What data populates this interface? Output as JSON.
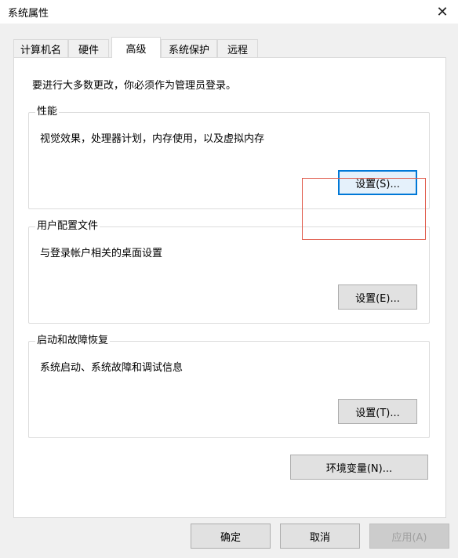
{
  "window": {
    "title": "系统属性",
    "close_glyph": "✕"
  },
  "tabs": [
    {
      "label": "计算机名"
    },
    {
      "label": "硬件"
    },
    {
      "label": "高级"
    },
    {
      "label": "系统保护"
    },
    {
      "label": "远程"
    }
  ],
  "active_tab": "高级",
  "advanced": {
    "admin_note": "要进行大多数更改，你必须作为管理员登录。",
    "performance": {
      "title": "性能",
      "desc": "视觉效果，处理器计划，内存使用，以及虚拟内存",
      "button": "设置(S)..."
    },
    "user_profiles": {
      "title": "用户配置文件",
      "desc": "与登录帐户相关的桌面设置",
      "button": "设置(E)..."
    },
    "startup_recovery": {
      "title": "启动和故障恢复",
      "desc": "系统启动、系统故障和调试信息",
      "button": "设置(T)..."
    },
    "env_vars_button": "环境变量(N)..."
  },
  "footer": {
    "ok": "确定",
    "cancel": "取消",
    "apply": "应用(A)"
  },
  "colors": {
    "focus_border": "#0078d7",
    "highlight_box": "#e05a4a"
  },
  "icons": {
    "close": "close-icon"
  }
}
